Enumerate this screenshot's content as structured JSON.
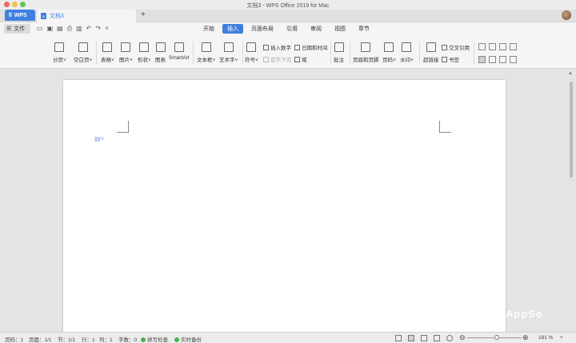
{
  "window": {
    "title": "文档3 - WPS Office 2019 for Mac"
  },
  "tabs": {
    "wps": "WPS",
    "doc": "文档3",
    "doc_icon": "W",
    "add": "+"
  },
  "menubar": {
    "file": "文件",
    "tabs": [
      "开始",
      "插入",
      "页面布局",
      "引用",
      "审阅",
      "视图",
      "章节"
    ],
    "active_tab": "插入"
  },
  "ribbon": {
    "page_break": "分页",
    "blank_page": "空白页",
    "table": "表格",
    "picture": "图片",
    "shape": "形状",
    "chart": "图表",
    "smartart": "SmartArt",
    "textbox": "文本框",
    "wordart": "艺术字",
    "symbol": "符号",
    "insert_number": "插入数字",
    "first_letter": "首字下沉",
    "datetime": "日期和时间",
    "field": "域",
    "comment": "批注",
    "header_footer": "页眉和页脚",
    "page_number": "页码",
    "watermark": "水印",
    "hyperlink": "超链接",
    "cross_ref": "交叉引用",
    "bookmark": "书签",
    "dropdown_glyph": "˅"
  },
  "statusbar": {
    "page_no": "页码：1",
    "pages": "页面：1/1",
    "section": "节：1/1",
    "row": "行：1",
    "col": "列：1",
    "words": "字数：0",
    "spellcheck": "拼写检查",
    "backup": "实时备份",
    "zoom": "181 %",
    "zoom_percent": 181
  },
  "watermark_text": "AppSo",
  "colors": {
    "accent": "#3f7fe0",
    "status_ok": "#4caf50"
  }
}
